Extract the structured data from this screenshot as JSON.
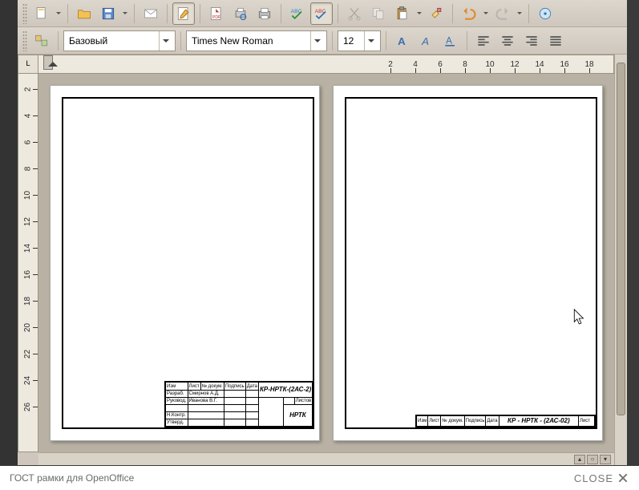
{
  "style_combo": "Базовый",
  "font_combo": "Times New Roman",
  "size_combo": "12",
  "hruler": [
    "2",
    "4",
    "6",
    "8",
    "10",
    "12",
    "14",
    "16",
    "18"
  ],
  "vruler": [
    "2",
    "4",
    "6",
    "8",
    "10",
    "12",
    "14",
    "16",
    "18",
    "20",
    "22",
    "24",
    "26"
  ],
  "page1": {
    "designation": "КР-НРТК-(2АС-2)",
    "org": "НРТК",
    "rows": [
      {
        "role": "Изм",
        "name": "",
        "sign": "",
        "date": ""
      },
      {
        "role": "Разраб.",
        "name": "Смирнов А.Д.",
        "sign": "",
        "date": ""
      },
      {
        "role": "Руковод.",
        "name": "Иванова В.Г.",
        "sign": "",
        "date": ""
      },
      {
        "role": "",
        "name": "",
        "sign": "",
        "date": ""
      },
      {
        "role": "Н.Контр.",
        "name": "",
        "sign": "",
        "date": ""
      },
      {
        "role": "Утверд.",
        "name": "",
        "sign": "",
        "date": ""
      }
    ],
    "hdr": {
      "c1": "Изм",
      "c2": "Лист",
      "c3": "№ докум.",
      "c4": "Подпись",
      "c5": "Дата"
    },
    "sheet_lbl": "Листов"
  },
  "page2": {
    "designation": "КР - НРТК - (2АС-02)",
    "hdr": {
      "c1": "Изм",
      "c2": "Лист",
      "c3": "№ докум.",
      "c4": "Подпись",
      "c5": "Дата"
    },
    "sheet_lbl": "Лист"
  },
  "caption": "ГОСТ рамки для OpenOffice",
  "close_label": "CLOSE",
  "corner": "L"
}
